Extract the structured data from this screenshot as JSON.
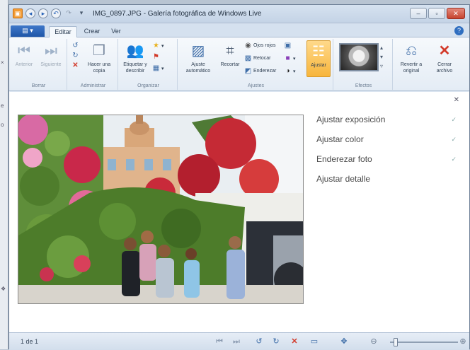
{
  "window": {
    "title": "IMG_0897.JPG - Galería fotográfica de Windows Live"
  },
  "tabs": {
    "file_label": "",
    "items": [
      {
        "label": "Editar"
      },
      {
        "label": "Crear"
      },
      {
        "label": "Ver"
      }
    ]
  },
  "ribbon": {
    "groups": {
      "borrar": "Borrar",
      "administrar": "Administrar",
      "organizar": "Organizar",
      "ajustes": "Ajustes",
      "efectos": "Efectos"
    },
    "anterior": "Anterior",
    "siguiente": "Siguiente",
    "hacer_copia": "Hacer una copia",
    "etiquetar": "Etiquetar y describir",
    "ajuste_auto": "Ajuste automático",
    "recortar": "Recortar",
    "ojos_rojos": "Ojos rojos",
    "retocar": "Retocar",
    "enderezar": "Enderezar",
    "ajustar": "Ajustar",
    "revertir": "Revertir a original",
    "cerrar": "Cerrar archivo"
  },
  "fix_pane": {
    "items": [
      {
        "label": "Ajustar exposición"
      },
      {
        "label": "Ajustar color"
      },
      {
        "label": "Enderezar foto"
      },
      {
        "label": "Ajustar detalle"
      }
    ]
  },
  "status": {
    "count": "1 de 1"
  },
  "zoom": {
    "level_fraction": 0.05
  },
  "colors": {
    "accent": "#2f6ec0",
    "selected": "#f7b53c",
    "close": "#d23a2a"
  }
}
